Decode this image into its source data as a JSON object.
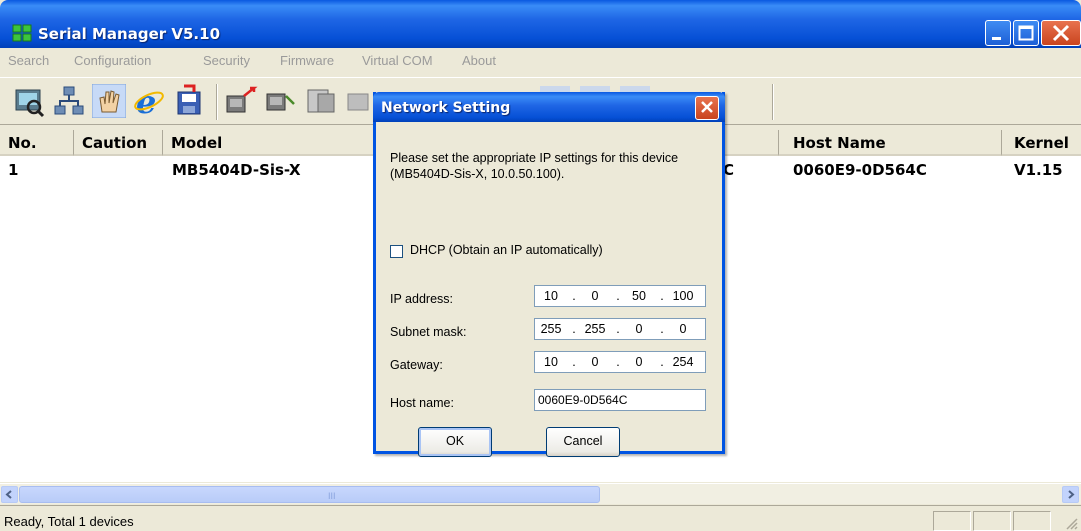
{
  "window": {
    "title": "Serial Manager V5.10"
  },
  "menu": [
    "Search",
    "Configuration",
    "Security",
    "Firmware",
    "Virtual COM",
    "About"
  ],
  "table": {
    "headers": {
      "no": "No.",
      "caution": "Caution",
      "model": "Model",
      "host": "Host Name",
      "kernel": "Kernel"
    },
    "rows": [
      {
        "no": "1",
        "model": "MB5404D-Sis-X",
        "mac_partial": "C",
        "host": "0060E9-0D564C",
        "kernel": "V1.15"
      }
    ]
  },
  "status": {
    "text": "Ready, Total 1 devices"
  },
  "dialog": {
    "title": "Network Setting",
    "description": "Please set the appropriate IP settings for this device (MB5404D-Sis-X, 10.0.50.100).",
    "dhcp_label": "DHCP (Obtain an IP automatically)",
    "ip_label": "IP address:",
    "ip": [
      "10",
      "0",
      "50",
      "100"
    ],
    "mask_label": "Subnet mask:",
    "mask": [
      "255",
      "255",
      "0",
      "0"
    ],
    "gw_label": "Gateway:",
    "gw": [
      "10",
      "0",
      "0",
      "254"
    ],
    "host_label": "Host name:",
    "host_value": "0060E9-0D564C",
    "ok": "OK",
    "cancel": "Cancel"
  },
  "scroll": {
    "grip": "III"
  },
  "colors": {
    "xp_blue": "#0054E3",
    "face": "#ECE9D8"
  }
}
